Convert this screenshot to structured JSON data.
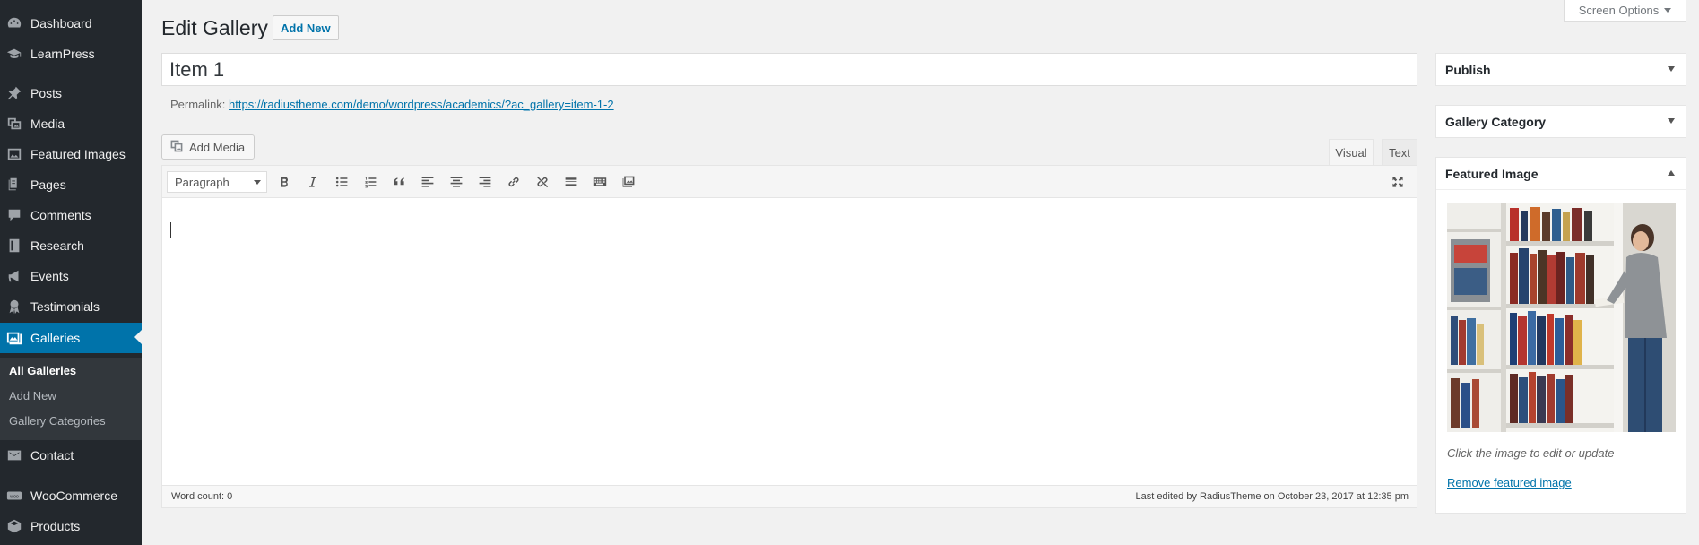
{
  "sidebar": {
    "items": [
      {
        "label": "Dashboard",
        "icon": "dashboard-icon"
      },
      {
        "label": "LearnPress",
        "icon": "graduation-cap-icon"
      },
      {
        "label": "Posts",
        "icon": "pin-icon"
      },
      {
        "label": "Media",
        "icon": "media-icon"
      },
      {
        "label": "Featured Images",
        "icon": "image-icon"
      },
      {
        "label": "Pages",
        "icon": "page-icon"
      },
      {
        "label": "Comments",
        "icon": "comment-icon"
      },
      {
        "label": "Research",
        "icon": "book-icon"
      },
      {
        "label": "Events",
        "icon": "megaphone-icon"
      },
      {
        "label": "Testimonials",
        "icon": "award-icon"
      },
      {
        "label": "Galleries",
        "icon": "gallery-icon",
        "current": true
      },
      {
        "label": "Contact",
        "icon": "mail-icon"
      },
      {
        "label": "WooCommerce",
        "icon": "woo-icon"
      },
      {
        "label": "Products",
        "icon": "box-icon"
      }
    ],
    "submenu": [
      {
        "label": "All Galleries",
        "active": true
      },
      {
        "label": "Add New"
      },
      {
        "label": "Gallery Categories"
      }
    ]
  },
  "header": {
    "title": "Edit Gallery",
    "add_new_label": "Add New",
    "screen_options_label": "Screen Options"
  },
  "post": {
    "title": "Item 1",
    "permalink_label": "Permalink:",
    "permalink_url": "https://radiustheme.com/demo/wordpress/academics/?ac_gallery=item-1-2"
  },
  "editor": {
    "add_media_label": "Add Media",
    "tabs": {
      "visual": "Visual",
      "text": "Text"
    },
    "format_selected": "Paragraph",
    "toolbar_buttons": [
      "bold-icon",
      "italic-icon",
      "bullet-list-icon",
      "numbered-list-icon",
      "blockquote-icon",
      "align-left-icon",
      "align-center-icon",
      "align-right-icon",
      "link-icon",
      "unlink-icon",
      "read-more-icon",
      "toolbar-toggle-icon",
      "image-icon",
      "fullscreen-icon"
    ],
    "word_count": "Word count: 0",
    "last_edited": "Last edited by RadiusTheme on October 23, 2017 at 12:35 pm"
  },
  "boxes": {
    "publish": "Publish",
    "category": "Gallery Category",
    "featured": {
      "title": "Featured Image",
      "hint": "Click the image to edit or update",
      "remove_label": "Remove featured image"
    }
  },
  "colors": {
    "admin_bar": "#23282d",
    "accent": "#0073aa",
    "background": "#f1f1f1"
  }
}
